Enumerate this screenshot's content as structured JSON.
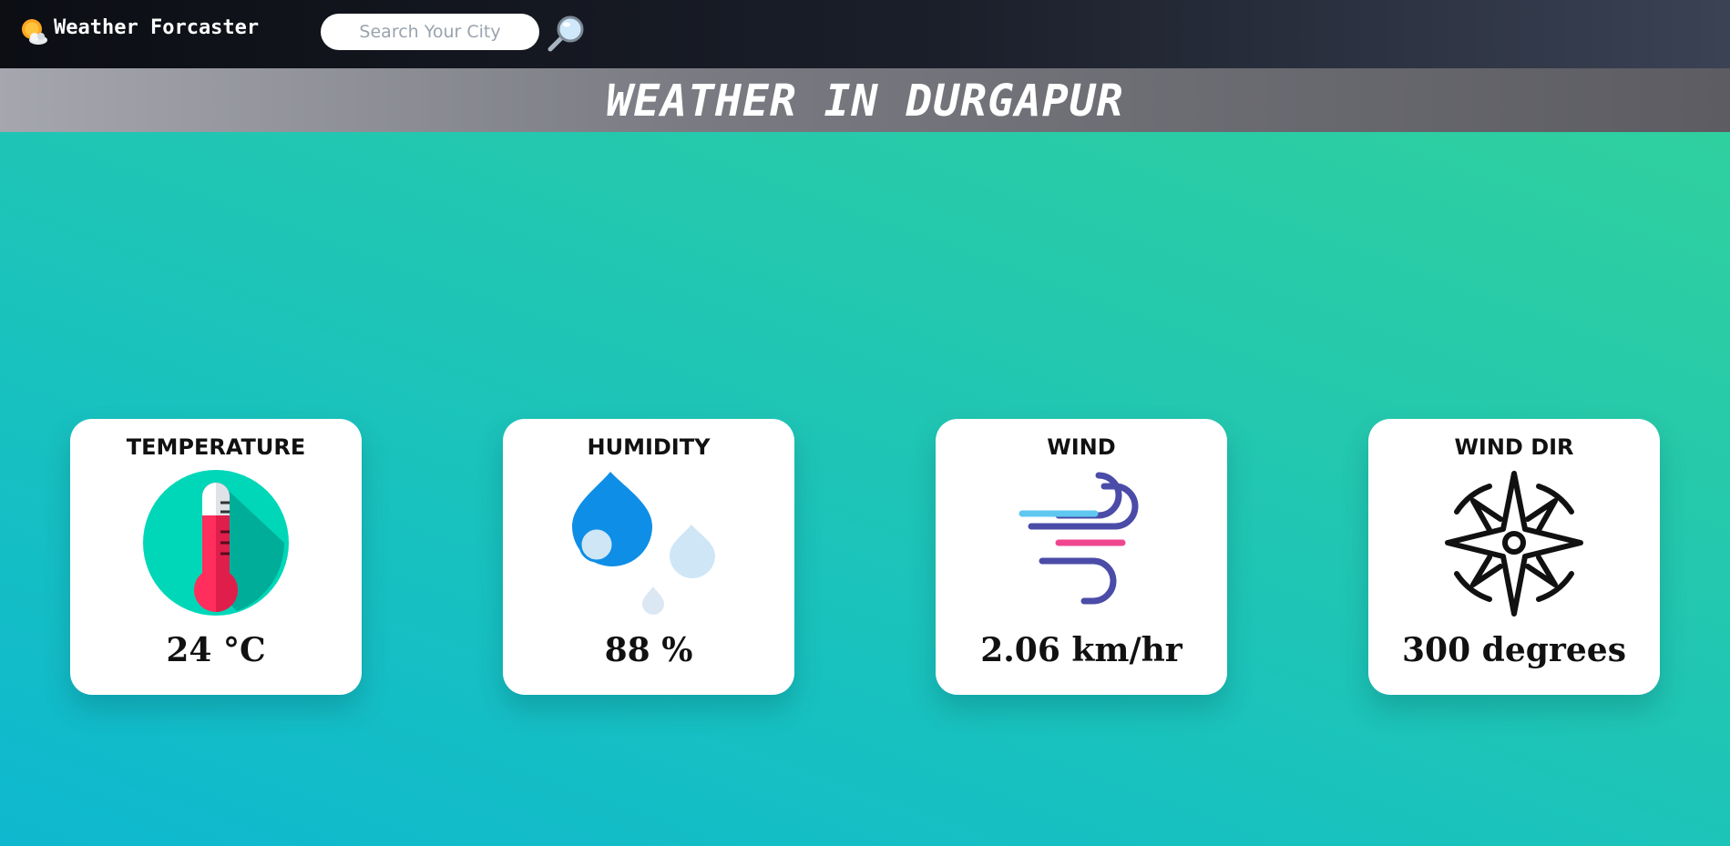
{
  "app": {
    "name": "Weather Forcaster"
  },
  "search": {
    "placeholder": "Search Your City",
    "value": ""
  },
  "header": {
    "title": "WEATHER IN DURGAPUR"
  },
  "cards": [
    {
      "title": "TEMPERATURE",
      "value": "24 °C",
      "icon": "thermometer-icon"
    },
    {
      "title": "HUMIDITY",
      "value": "88 %",
      "icon": "water-drops-icon"
    },
    {
      "title": "WIND",
      "value": "2.06 km/hr",
      "icon": "wind-icon"
    },
    {
      "title": "WIND DIR",
      "value": "300 degrees",
      "icon": "compass-icon"
    }
  ],
  "colors": {
    "navbar": "#14171f",
    "background_start": "#33d29a",
    "background_end": "#0fb8cf",
    "thermo_circle": "#00d7b8",
    "thermo_red": "#ff2e5c",
    "drop_blue": "#0e8ee6",
    "drop_light": "#cfe6f7",
    "wind_purple": "#4b4ca8",
    "wind_cyan": "#5fc8f0",
    "wind_pink": "#f0468f"
  }
}
